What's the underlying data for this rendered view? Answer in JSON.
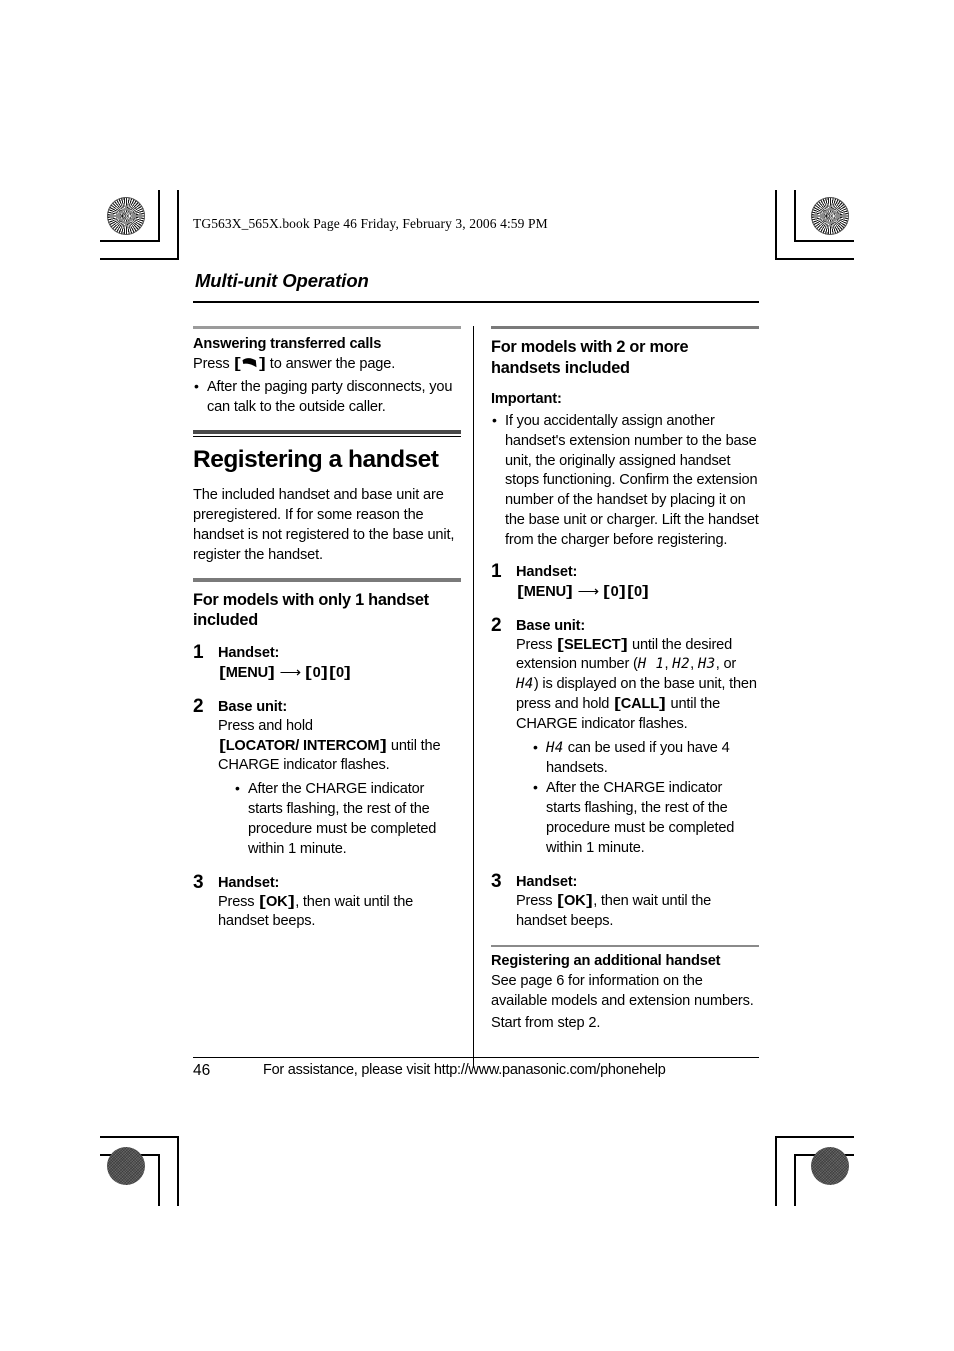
{
  "running_head": "TG563X_565X.book  Page 46  Friday, February 3, 2006  4:59 PM",
  "chapter_title": "Multi-unit Operation",
  "left_column": {
    "section_answering": {
      "heading": "Answering transferred calls",
      "intro_before_key": "Press ",
      "key_icon": "talk-phone-icon",
      "intro_after_key": " to answer the page.",
      "bullets": [
        "After the paging party disconnects, you can talk to the outside caller."
      ]
    },
    "section_registering": {
      "title": "Registering a handset",
      "paragraph": "The included handset and base unit are preregistered. If for some reason the handset is not registered to the base unit, register the handset."
    },
    "section_one_handset": {
      "heading": "For models with only 1 handset included",
      "steps": [
        {
          "num": "1",
          "label": "Handset:",
          "keys": "[MENU]  →  [0][0]",
          "key_menu": "MENU",
          "key_zero_a": "0",
          "key_zero_b": "0"
        },
        {
          "num": "2",
          "label": "Base unit:",
          "body_pre": "Press and hold ",
          "body_key": "[LOCATOR/ INTERCOM]",
          "body_key_line1": "LOCATOR/",
          "body_key_line2": "INTERCOM",
          "body_post": " until the CHARGE indicator flashes.",
          "bullets": [
            "After the CHARGE indicator starts flashing, the rest of the procedure must be completed within 1 minute."
          ]
        },
        {
          "num": "3",
          "label": "Handset:",
          "body_pre": "Press ",
          "body_key": "OK",
          "body_post": ", then wait until the handset beeps."
        }
      ]
    }
  },
  "right_column": {
    "section_two_handsets": {
      "heading": "For models with 2 or more handsets included",
      "important_label": "Important:",
      "important_bullets": [
        "If you accidentally assign another handset's extension number to the base unit, the originally assigned handset stops functioning. Confirm the extension number of the handset by placing it on the base unit or charger. Lift the handset from the charger before registering."
      ],
      "steps": [
        {
          "num": "1",
          "label": "Handset:",
          "key_menu": "MENU",
          "key_zero_a": "0",
          "key_zero_b": "0"
        },
        {
          "num": "2",
          "label": "Base unit:",
          "body_pre": "Press ",
          "key_select": "SELECT",
          "body_mid1": " until the desired extension number (",
          "lcd_1": "H 1",
          "lcd_sep1": ", ",
          "lcd_2": "H2",
          "lcd_sep2": ", ",
          "lcd_3": "H3",
          "lcd_sep3": ", or ",
          "lcd_4": "H4",
          "body_mid2": ") is displayed on the base unit, then press and hold ",
          "key_call": "CALL",
          "body_post": " until the CHARGE indicator flashes.",
          "bullets": [
            {
              "lcd": "H4",
              "text": " can be used if you have 4 handsets."
            },
            {
              "lcd": "",
              "text": "After the CHARGE indicator starts flashing, the rest of the procedure must be completed within 1 minute."
            }
          ]
        },
        {
          "num": "3",
          "label": "Handset:",
          "body_pre": "Press ",
          "body_key": "OK",
          "body_post": ", then wait until the handset beeps."
        }
      ]
    },
    "section_additional": {
      "heading": "Registering an additional handset",
      "paragraph_1": "See page 6 for information on the available models and extension numbers.",
      "paragraph_2": "Start from step 2."
    }
  },
  "footer": {
    "page_number": "46",
    "note": "For assistance, please visit http://www.panasonic.com/phonehelp"
  },
  "colors": {
    "text": "#000000",
    "rule_light": "#9b9b9b",
    "rule_mid": "#7a7a7a",
    "rule_dark": "#4a4a4a",
    "page_bg": "#ffffff"
  }
}
